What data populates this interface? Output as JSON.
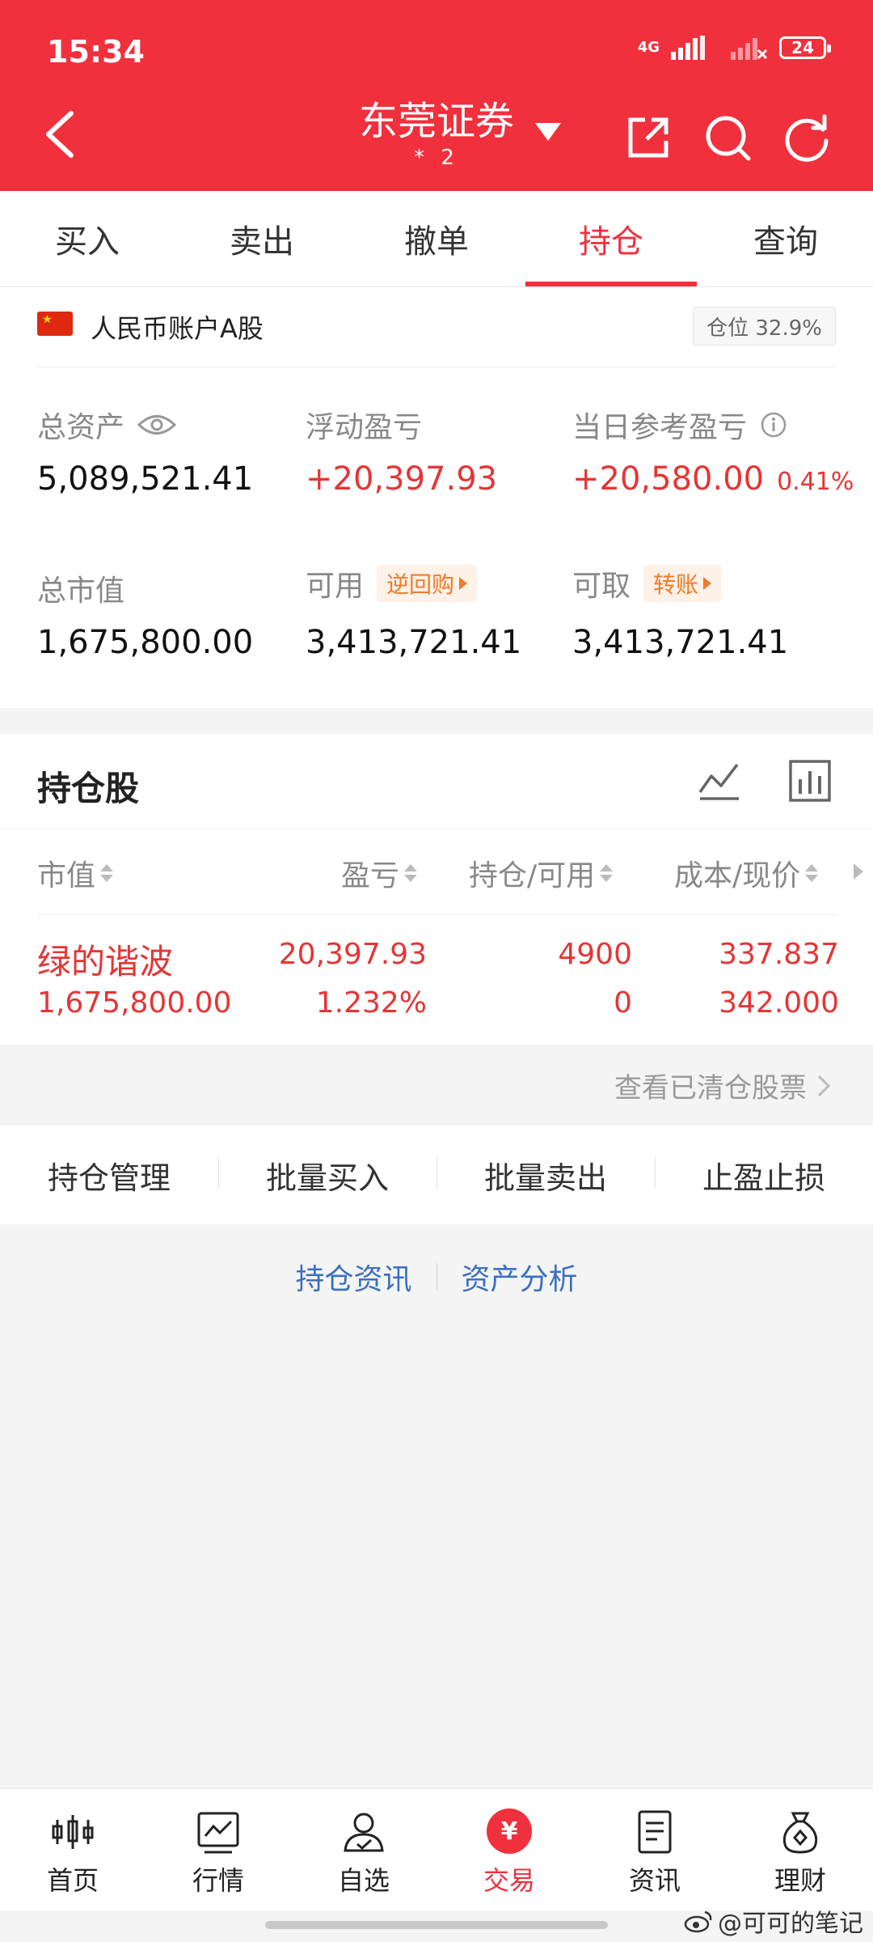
{
  "status": {
    "time": "15:34",
    "network": "4G",
    "battery": "24"
  },
  "header": {
    "title": "东莞证券",
    "account_id": "*      2"
  },
  "tabs": [
    {
      "label": "买入"
    },
    {
      "label": "卖出"
    },
    {
      "label": "撤单"
    },
    {
      "label": "持仓"
    },
    {
      "label": "查询"
    }
  ],
  "account": {
    "name": "人民币账户A股",
    "position_ratio": "仓位 32.9%",
    "total_assets_label": "总资产",
    "total_assets": "5,089,521.41",
    "floating_pl_label": "浮动盈亏",
    "floating_pl": "+20,397.93",
    "daily_pl_label": "当日参考盈亏",
    "daily_pl": "+20,580.00",
    "daily_pl_pct": "0.41%",
    "market_value_label": "总市值",
    "market_value": "1,675,800.00",
    "available_label": "可用",
    "available_tag": "逆回购",
    "available": "3,413,721.41",
    "withdrawable_label": "可取",
    "withdrawable_tag": "转账",
    "withdrawable": "3,413,721.41"
  },
  "holdings": {
    "title": "持仓股",
    "columns": [
      "市值",
      "盈亏",
      "持仓/可用",
      "成本/现价"
    ],
    "rows": [
      {
        "name": "绿的谐波",
        "market_value": "1,675,800.00",
        "pl": "20,397.93",
        "pl_pct": "1.232%",
        "position": "4900",
        "available": "0",
        "cost": "337.837",
        "price": "342.000"
      }
    ],
    "cleared_link": "查看已清仓股票"
  },
  "actions": [
    "持仓管理",
    "批量买入",
    "批量卖出",
    "止盈止损"
  ],
  "links": [
    "持仓资讯",
    "资产分析"
  ],
  "nav": [
    {
      "label": "首页",
      "icon": "candlestick-icon"
    },
    {
      "label": "行情",
      "icon": "trend-chart-icon"
    },
    {
      "label": "自选",
      "icon": "user-check-icon"
    },
    {
      "label": "交易",
      "icon": "yuan-icon"
    },
    {
      "label": "资讯",
      "icon": "document-icon"
    },
    {
      "label": "理财",
      "icon": "money-bag-icon"
    }
  ],
  "watermark": "@可可的笔记",
  "colors": {
    "brand": "#f0303c",
    "profit": "#e53535",
    "link": "#3a6fc0",
    "tag": "#f07b28"
  }
}
